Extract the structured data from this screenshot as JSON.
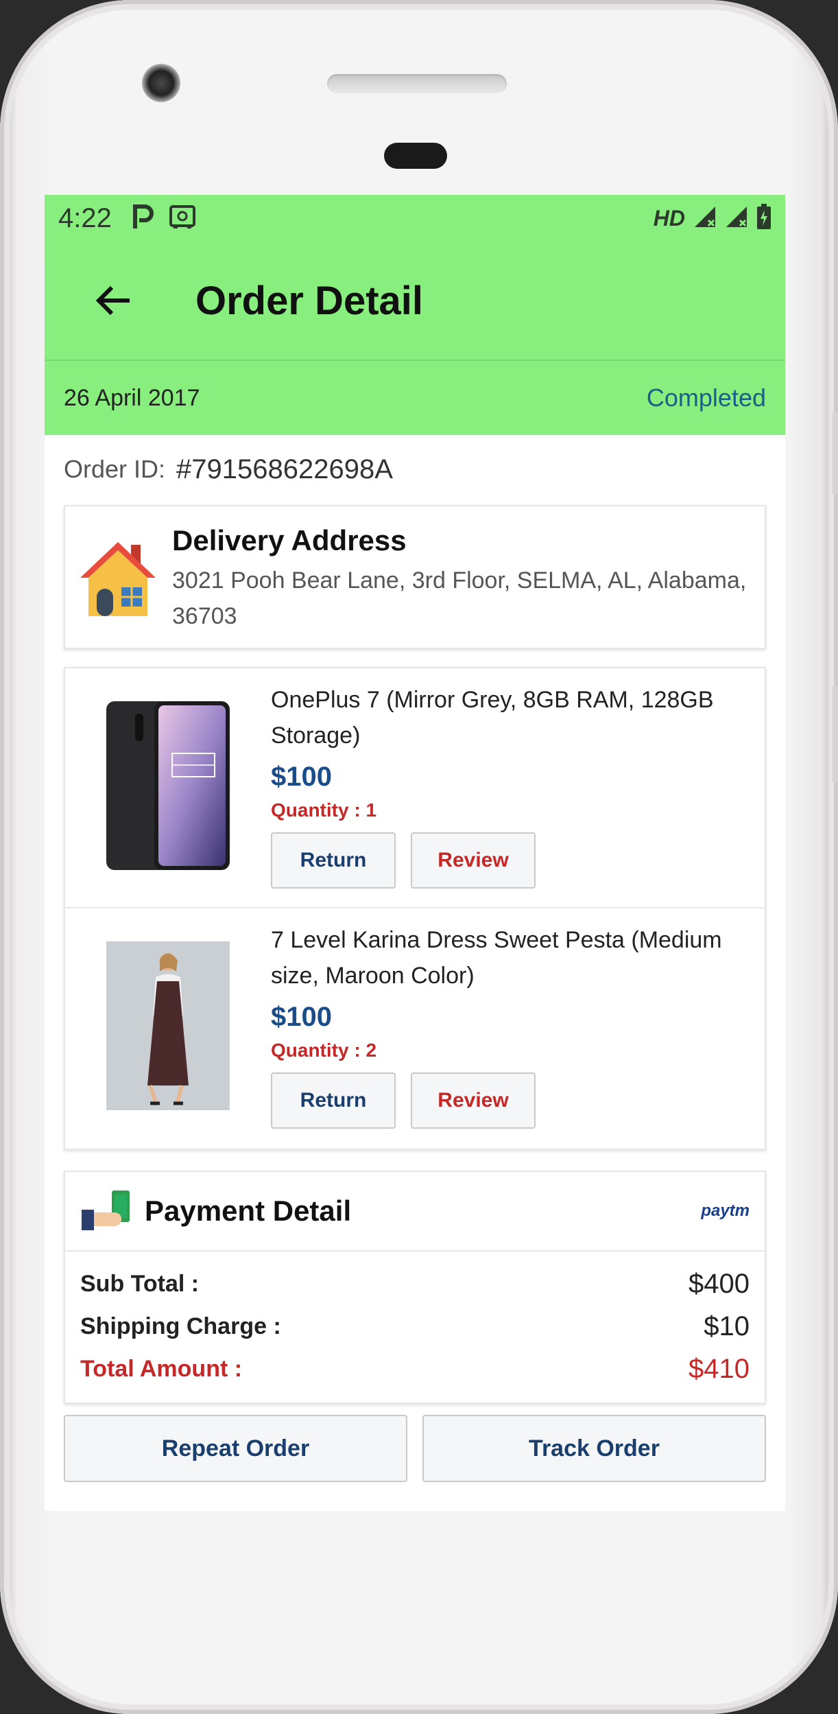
{
  "statusbar": {
    "time": "4:22",
    "network_label": "HD"
  },
  "appbar": {
    "title": "Order Detail"
  },
  "order": {
    "date": "26 April 2017",
    "status": "Completed",
    "id_label": "Order ID:",
    "id_value": "#791568622698A"
  },
  "address": {
    "title": "Delivery Address",
    "line": "3021 Pooh Bear Lane, 3rd Floor, SELMA, AL, Alabama, 36703"
  },
  "items": [
    {
      "name": "OnePlus 7 (Mirror Grey, 8GB RAM, 128GB Storage)",
      "price": "$100",
      "quantity": "Quantity : 1",
      "return_label": "Return",
      "review_label": "Review"
    },
    {
      "name": "7 Level Karina Dress Sweet Pesta (Medium size, Maroon Color)",
      "price": "$100",
      "quantity": "Quantity : 2",
      "return_label": "Return",
      "review_label": "Review"
    }
  ],
  "payment": {
    "title": "Payment Detail",
    "method": "paytm",
    "sub_total_label": "Sub Total :",
    "sub_total_value": "$400",
    "shipping_label": "Shipping Charge :",
    "shipping_value": "$10",
    "total_label": "Total Amount :",
    "total_value": "$410"
  },
  "actions": {
    "repeat_label": "Repeat Order",
    "track_label": "Track Order"
  },
  "colors": {
    "header": "#88ee7e",
    "accent_blue": "#1a3f6e",
    "accent_red": "#c62828"
  }
}
